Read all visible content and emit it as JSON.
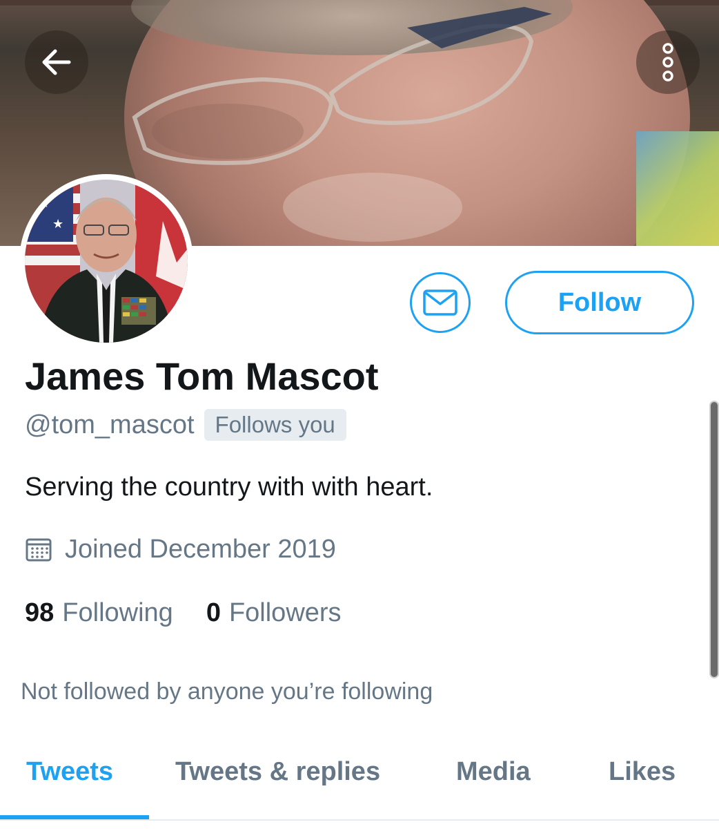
{
  "profile": {
    "name": "James Tom Mascot",
    "handle": "@tom_mascot",
    "follows_you_badge": "Follows you",
    "bio": "Serving the country with with heart.",
    "joined": "Joined December 2019",
    "following_count": "98",
    "following_label": "Following",
    "followers_count": "0",
    "followers_label": "Followers",
    "mutuals_note": "Not followed by anyone you’re following"
  },
  "actions": {
    "follow_label": "Follow",
    "message_icon": "envelope-icon",
    "back_icon": "arrow-left-icon",
    "more_icon": "more-vertical-icon"
  },
  "tabs": [
    {
      "label": "Tweets",
      "active": true
    },
    {
      "label": "Tweets & replies",
      "active": false
    },
    {
      "label": "Media",
      "active": false
    },
    {
      "label": "Likes",
      "active": false
    }
  ],
  "colors": {
    "accent": "#1da1f2",
    "secondary_text": "#657786",
    "primary_text": "#14171a",
    "badge_bg": "#e6ecf0"
  }
}
